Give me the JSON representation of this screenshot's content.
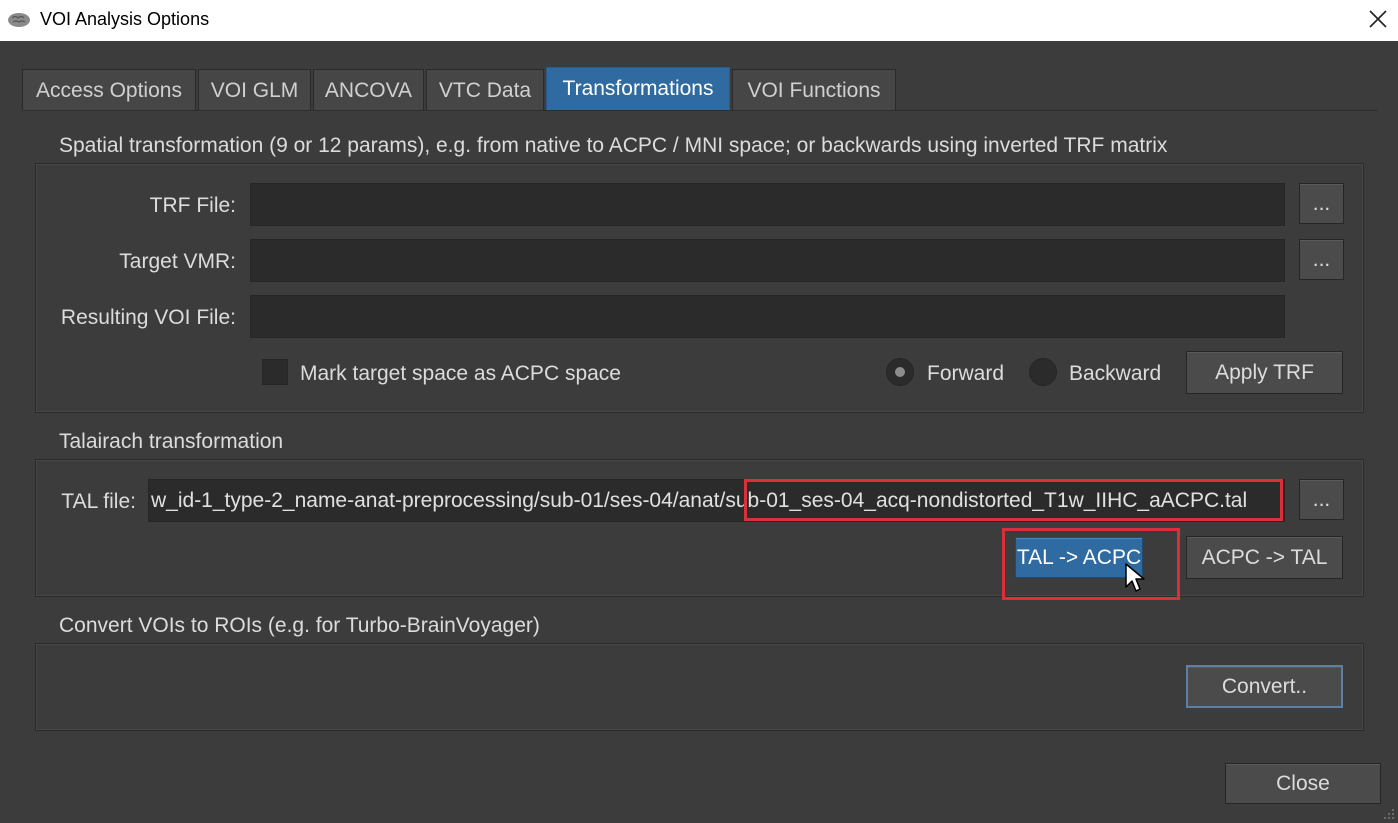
{
  "window": {
    "title": "VOI Analysis Options",
    "icon": "brain-icon"
  },
  "tabs": [
    {
      "label": "Access Options",
      "active": false
    },
    {
      "label": "VOI GLM",
      "active": false
    },
    {
      "label": "ANCOVA",
      "active": false
    },
    {
      "label": "VTC Data",
      "active": false
    },
    {
      "label": "Transformations",
      "active": true
    },
    {
      "label": "VOI Functions",
      "active": false
    }
  ],
  "spatial": {
    "title": "Spatial transformation (9 or 12 params), e.g. from native to ACPC / MNI space; or backwards using inverted TRF matrix",
    "trf_label": "TRF File:",
    "trf_value": "",
    "target_label": "Target VMR:",
    "target_value": "",
    "result_label": "Resulting VOI File:",
    "result_value": "",
    "browse_label": "...",
    "acpc_checkbox_label": "Mark target space as ACPC space",
    "acpc_checked": false,
    "forward_label": "Forward",
    "backward_label": "Backward",
    "direction": "Forward",
    "apply_label": "Apply TRF"
  },
  "talairach": {
    "title": "Talairach transformation",
    "tal_label": "TAL file:",
    "tal_value_path": "w_id-1_type-2_name-anat-preprocessing/sub-01/ses-04/anat/",
    "tal_value_file": "sub-01_ses-04_acq-nondistorted_T1w_IIHC_aACPC.tal",
    "browse_label": "...",
    "tal_to_acpc_label": "TAL -> ACPC",
    "acpc_to_tal_label": "ACPC -> TAL"
  },
  "convert": {
    "title": "Convert VOIs to ROIs (e.g. for Turbo-BrainVoyager)",
    "button_label": "Convert.."
  },
  "footer": {
    "close_label": "Close"
  },
  "colors": {
    "accent": "#2f6ba1",
    "highlight": "#d9303a",
    "background": "#3c3c3c"
  }
}
